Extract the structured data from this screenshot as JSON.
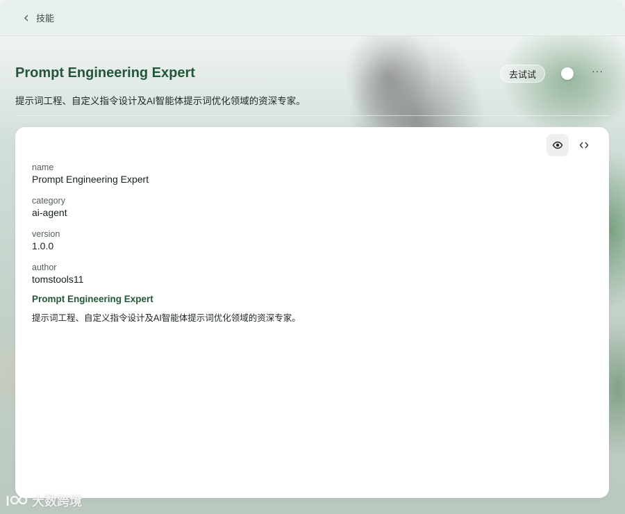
{
  "topbar": {
    "back_label": "技能"
  },
  "header": {
    "title": "Prompt Engineering Expert",
    "subtitle": "提示词工程、自定义指令设计及AI智能体提示词优化领域的资深专家。",
    "try_button": "去试试",
    "more_label": "···"
  },
  "card": {
    "fields": [
      {
        "key": "name",
        "value": "Prompt Engineering Expert"
      },
      {
        "key": "category",
        "value": "ai-agent"
      },
      {
        "key": "version",
        "value": "1.0.0"
      },
      {
        "key": "author",
        "value": "tomstools11"
      }
    ],
    "body_title": "Prompt Engineering Expert",
    "body_text": "提示词工程、自定义指令设计及AI智能体提示词优化领域的资深专家。",
    "view_mode": "preview"
  },
  "watermark": {
    "text": "大数跨境"
  },
  "icons": [
    "chevron-left-icon",
    "eye-icon",
    "code-icon",
    "more-icon",
    "watermark-logo"
  ],
  "colors": {
    "accent": "#245638",
    "card_bg": "#ffffff",
    "topbar_bg": "#e9f1ec"
  }
}
